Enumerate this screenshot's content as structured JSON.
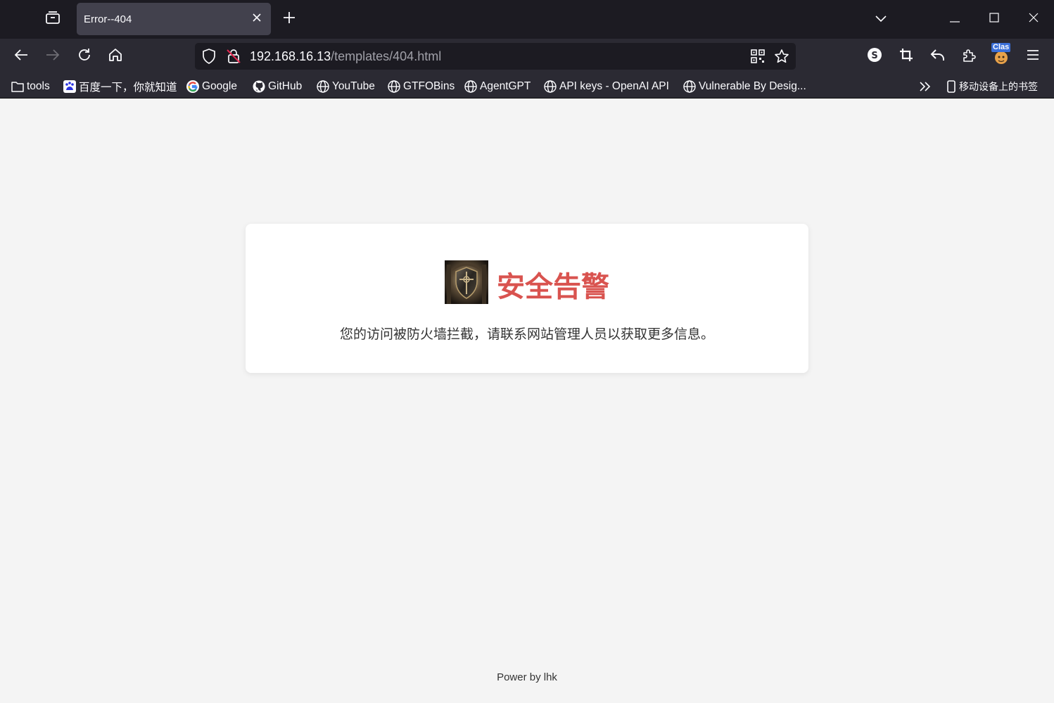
{
  "browser": {
    "tab": {
      "title": "Error--404"
    },
    "url": {
      "host": "192.168.16.13",
      "path": "/templates/404.html"
    },
    "extensions": {
      "clash_badge": "Clas"
    },
    "bookmarks": [
      {
        "label": "tools",
        "icon": "folder-icon"
      },
      {
        "label": "百度一下，你就知道",
        "icon": "baidu-icon"
      },
      {
        "label": "Google",
        "icon": "google-icon"
      },
      {
        "label": "GitHub",
        "icon": "github-icon"
      },
      {
        "label": "YouTube",
        "icon": "globe-icon"
      },
      {
        "label": "GTFOBins",
        "icon": "globe-icon"
      },
      {
        "label": "AgentGPT",
        "icon": "globe-icon"
      },
      {
        "label": "API keys - OpenAI API",
        "icon": "globe-icon"
      },
      {
        "label": "Vulnerable By Desig...",
        "icon": "globe-icon"
      }
    ],
    "mobile_bookmarks": "移动设备上的书签"
  },
  "page": {
    "alert_title": "安全告警",
    "alert_message": "您的访问被防火墙拦截，请联系网站管理人员以获取更多信息。",
    "footer": "Power by lhk"
  },
  "colors": {
    "alert_title": "#d9534f",
    "page_bg": "#f4f4f4",
    "toolbar_bg": "#2b2a33",
    "tabbar_bg": "#1c1b22"
  }
}
